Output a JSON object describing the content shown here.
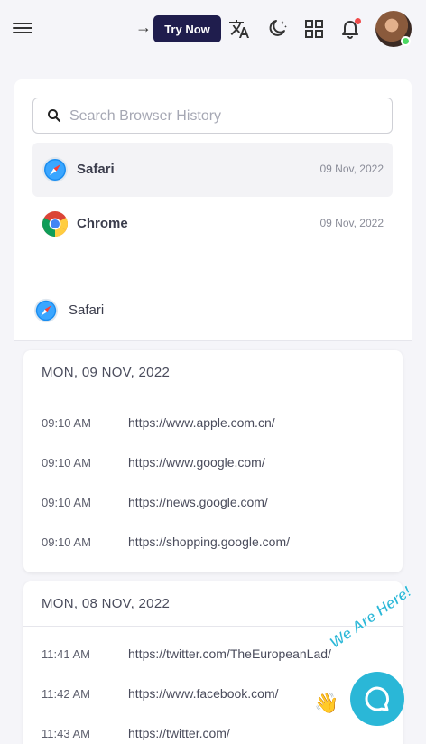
{
  "topbar": {
    "try_now_label": "Try Now",
    "icons": [
      "menu-icon",
      "arrow-right-icon",
      "translate-icon",
      "dark-mode-icon",
      "apps-grid-icon",
      "bell-icon",
      "avatar"
    ]
  },
  "search": {
    "placeholder": "Search Browser History",
    "value": ""
  },
  "browsers": [
    {
      "name": "Safari",
      "date": "09 Nov, 2022",
      "icon": "safari-icon",
      "active": true
    },
    {
      "name": "Chrome",
      "date": "09 Nov, 2022",
      "icon": "chrome-icon",
      "active": false
    }
  ],
  "selected_browser": {
    "name": "Safari",
    "icon": "safari-icon"
  },
  "history": [
    {
      "day": "MON, 09 NOV, 2022",
      "entries": [
        {
          "time": "09:10 AM",
          "url": "https://www.apple.com.cn/"
        },
        {
          "time": "09:10 AM",
          "url": "https://www.google.com/"
        },
        {
          "time": "09:10 AM",
          "url": "https://news.google.com/"
        },
        {
          "time": "09:10 AM",
          "url": "https://shopping.google.com/"
        }
      ]
    },
    {
      "day": "MON, 08 NOV, 2022",
      "entries": [
        {
          "time": "11:41 AM",
          "url": "https://twitter.com/TheEuropeanLad/"
        },
        {
          "time": "11:42 AM",
          "url": "https://www.facebook.com/"
        },
        {
          "time": "11:43 AM",
          "url": "https://twitter.com/"
        }
      ]
    }
  ],
  "chat": {
    "label": "We Are Here!",
    "wave": "👋"
  },
  "colors": {
    "accent": "#1f1d4d",
    "chat": "#2ab7d7",
    "notification": "#f04b4b",
    "online": "#4cd964"
  }
}
